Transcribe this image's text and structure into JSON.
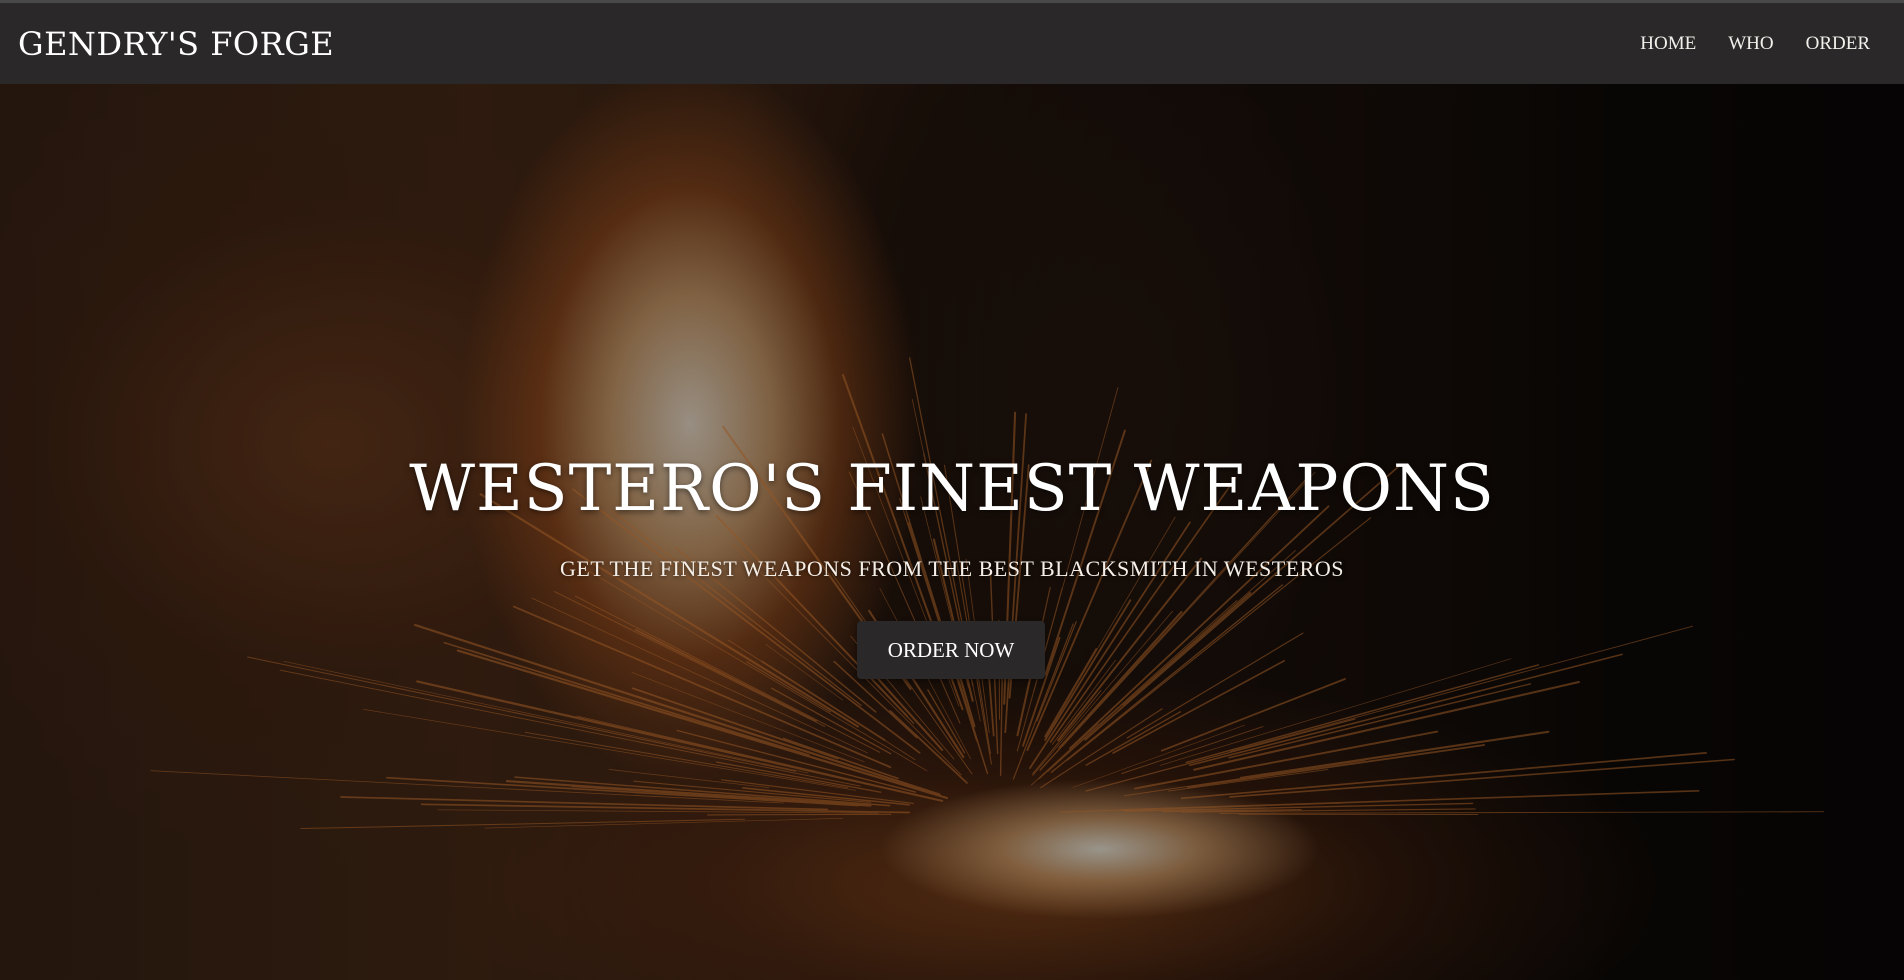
{
  "navbar": {
    "brand": "Gendry's Forge",
    "links": [
      "Home",
      "Who",
      "Order"
    ]
  },
  "hero": {
    "title": "Westero's Finest Weapons",
    "subtitle": "Get the finest weapons from the best blacksmith in Westeros",
    "cta_label": "Order Now",
    "background": "forge-sparks-photo"
  },
  "colors": {
    "navbar_bg": "#2a2829",
    "button_bg": "#2a2829",
    "text": "#ffffff",
    "spark": "#f08a3a"
  }
}
